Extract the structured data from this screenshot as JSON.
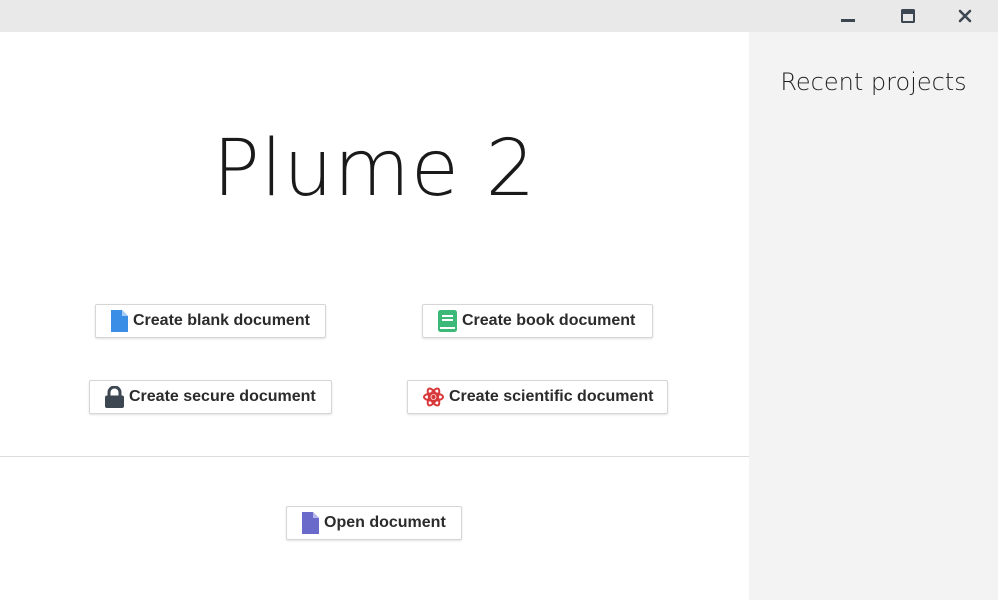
{
  "app": {
    "title": "Plume 2"
  },
  "window_controls": {
    "minimize": "minimize-icon",
    "maximize": "maximize-icon",
    "close": "close-icon"
  },
  "sidebar": {
    "title": "Recent projects"
  },
  "actions": {
    "blank": {
      "label": "Create blank document",
      "icon": "file-icon",
      "color": "#3a8ee6"
    },
    "book": {
      "label": "Create book document",
      "icon": "book-icon",
      "color": "#3cb878"
    },
    "secure": {
      "label": "Create secure document",
      "icon": "lock-icon",
      "color": "#3d4752"
    },
    "scientific": {
      "label": "Create scientific document",
      "icon": "atom-icon",
      "color": "#d9383a"
    },
    "open": {
      "label": "Open document",
      "icon": "file-icon",
      "color": "#6a6acb"
    }
  }
}
